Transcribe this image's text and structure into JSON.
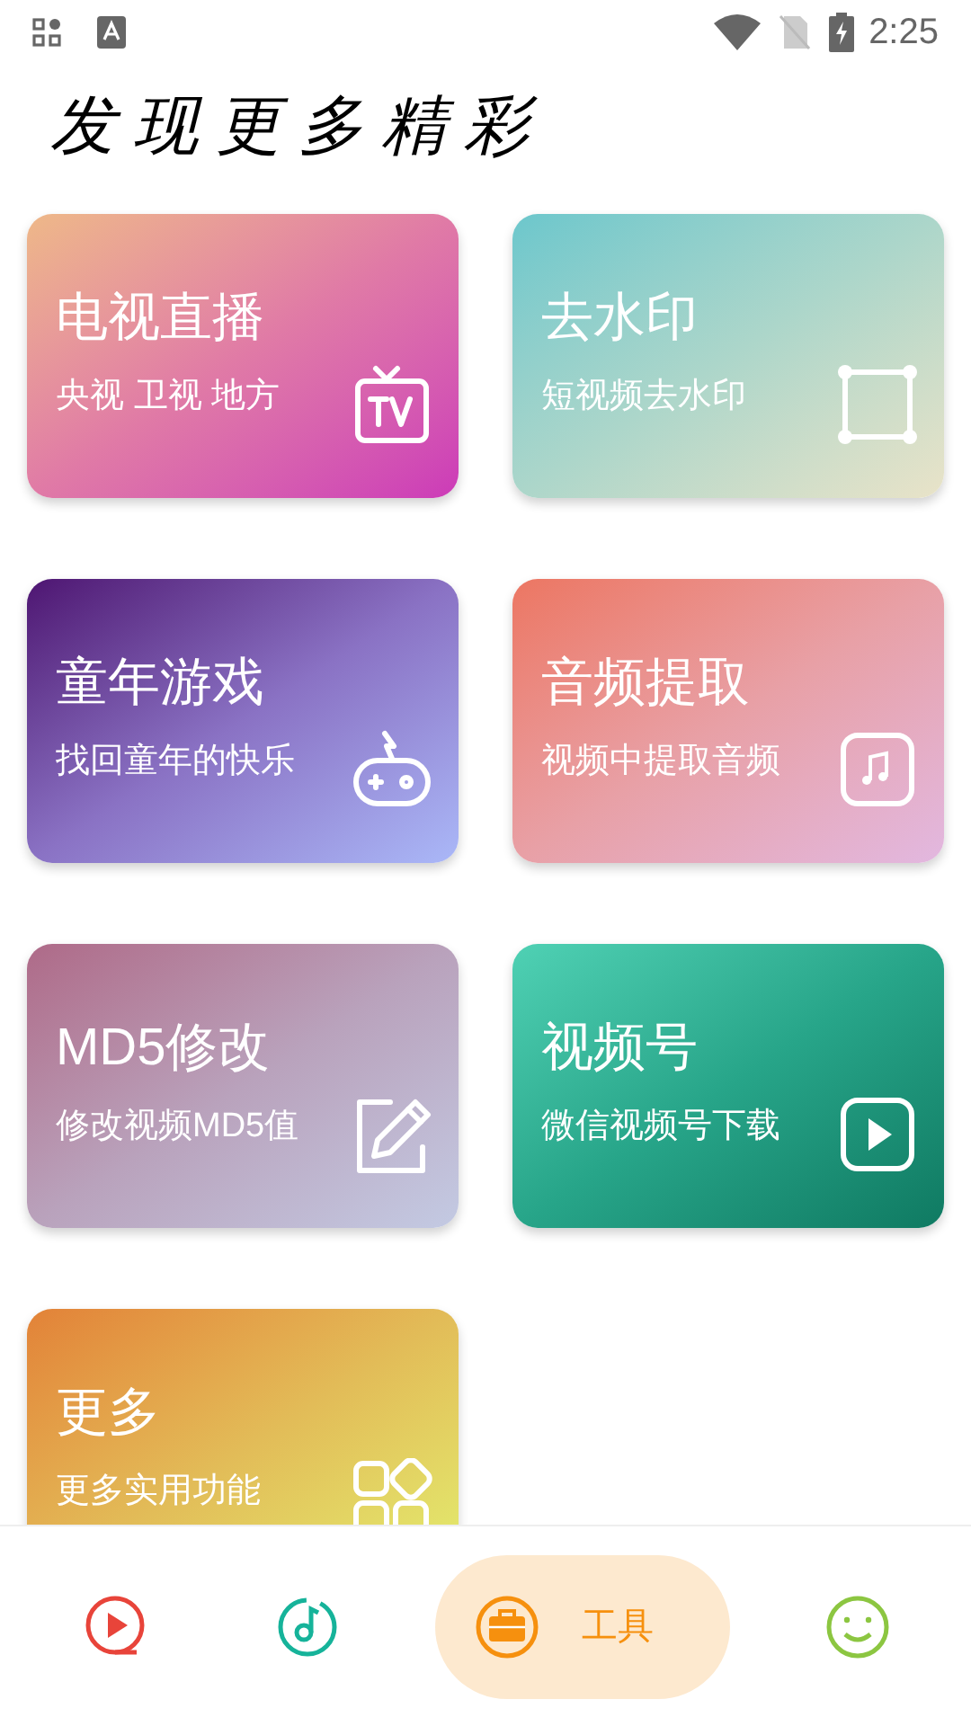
{
  "status_bar": {
    "time": "2:25"
  },
  "title": "发现更多精彩",
  "cards": [
    {
      "kind": "tv",
      "title": "电视直播",
      "subtitle": "央视 卫视 地方"
    },
    {
      "kind": "frame",
      "title": "去水印",
      "subtitle": "短视频去水印"
    },
    {
      "kind": "gamepad",
      "title": "童年游戏",
      "subtitle": "找回童年的快乐"
    },
    {
      "kind": "music",
      "title": "音频提取",
      "subtitle": "视频中提取音频"
    },
    {
      "kind": "edit",
      "title": "MD5修改",
      "subtitle": "修改视频MD5值"
    },
    {
      "kind": "play",
      "title": "视频号",
      "subtitle": "微信视频号下载"
    },
    {
      "kind": "grid",
      "title": "更多",
      "subtitle": "更多实用功能"
    }
  ],
  "nav": [
    {
      "kind": "video",
      "selected": false
    },
    {
      "kind": "music",
      "selected": false
    },
    {
      "kind": "tools",
      "selected": true,
      "label": "工具"
    },
    {
      "kind": "smile",
      "selected": false
    }
  ]
}
